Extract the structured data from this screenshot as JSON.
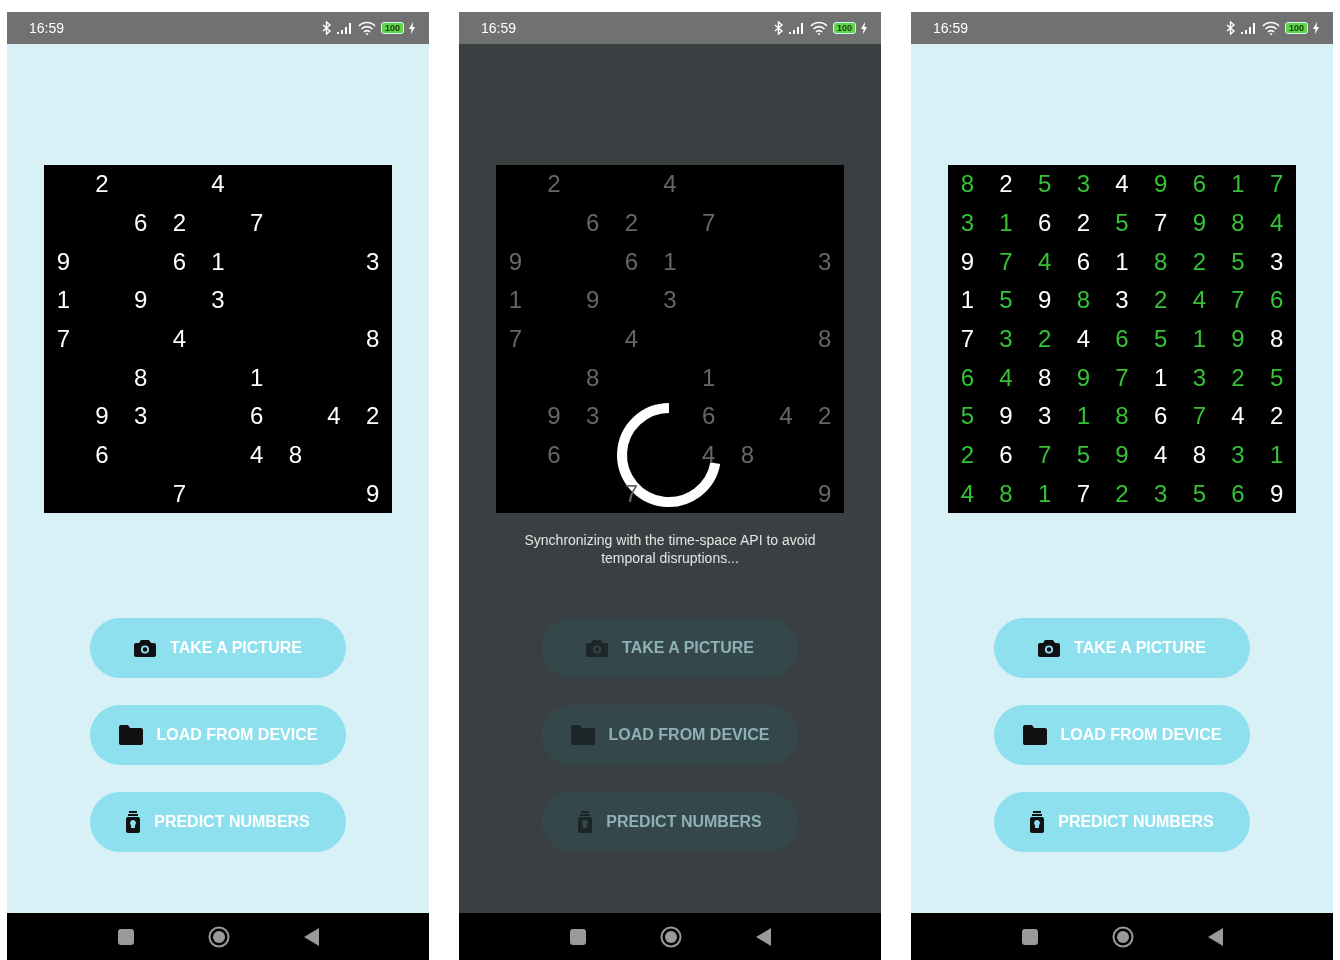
{
  "screens": [
    {
      "status_bar": {
        "time": "16:59",
        "battery": "100"
      },
      "grid": {
        "rows": [
          [
            null,
            {
              "digit": "2",
              "kind": "given"
            },
            null,
            null,
            {
              "digit": "4",
              "kind": "given"
            },
            null,
            null,
            null,
            null
          ],
          [
            null,
            null,
            {
              "digit": "6",
              "kind": "given"
            },
            {
              "digit": "2",
              "kind": "given"
            },
            null,
            {
              "digit": "7",
              "kind": "given"
            },
            null,
            null,
            null
          ],
          [
            {
              "digit": "9",
              "kind": "given"
            },
            null,
            null,
            {
              "digit": "6",
              "kind": "given"
            },
            {
              "digit": "1",
              "kind": "given"
            },
            null,
            null,
            null,
            {
              "digit": "3",
              "kind": "given"
            }
          ],
          [
            {
              "digit": "1",
              "kind": "given"
            },
            null,
            {
              "digit": "9",
              "kind": "given"
            },
            null,
            {
              "digit": "3",
              "kind": "given"
            },
            null,
            null,
            null,
            null
          ],
          [
            {
              "digit": "7",
              "kind": "given"
            },
            null,
            null,
            {
              "digit": "4",
              "kind": "given"
            },
            null,
            null,
            null,
            null,
            {
              "digit": "8",
              "kind": "given"
            }
          ],
          [
            null,
            null,
            {
              "digit": "8",
              "kind": "given"
            },
            null,
            null,
            {
              "digit": "1",
              "kind": "given"
            },
            null,
            null,
            null
          ],
          [
            null,
            {
              "digit": "9",
              "kind": "given"
            },
            {
              "digit": "3",
              "kind": "given"
            },
            null,
            null,
            {
              "digit": "6",
              "kind": "given"
            },
            null,
            {
              "digit": "4",
              "kind": "given"
            },
            {
              "digit": "2",
              "kind": "given"
            }
          ],
          [
            null,
            {
              "digit": "6",
              "kind": "given"
            },
            null,
            null,
            null,
            {
              "digit": "4",
              "kind": "given"
            },
            {
              "digit": "8",
              "kind": "given"
            },
            null,
            null
          ],
          [
            null,
            null,
            null,
            {
              "digit": "7",
              "kind": "given"
            },
            null,
            null,
            null,
            null,
            {
              "digit": "9",
              "kind": "given"
            }
          ]
        ]
      },
      "buttons": [
        {
          "label": "TAKE A PICTURE"
        },
        {
          "label": "LOAD FROM DEVICE"
        },
        {
          "label": "PREDICT NUMBERS"
        }
      ]
    },
    {
      "status_bar": {
        "time": "16:59",
        "battery": "100"
      },
      "grid": {
        "rows": [
          [
            null,
            {
              "digit": "2",
              "kind": "given"
            },
            null,
            null,
            {
              "digit": "4",
              "kind": "given"
            },
            null,
            null,
            null,
            null
          ],
          [
            null,
            null,
            {
              "digit": "6",
              "kind": "given"
            },
            {
              "digit": "2",
              "kind": "given"
            },
            null,
            {
              "digit": "7",
              "kind": "given"
            },
            null,
            null,
            null
          ],
          [
            {
              "digit": "9",
              "kind": "given"
            },
            null,
            null,
            {
              "digit": "6",
              "kind": "given"
            },
            {
              "digit": "1",
              "kind": "given"
            },
            null,
            null,
            null,
            {
              "digit": "3",
              "kind": "given"
            }
          ],
          [
            {
              "digit": "1",
              "kind": "given"
            },
            null,
            {
              "digit": "9",
              "kind": "given"
            },
            null,
            {
              "digit": "3",
              "kind": "given"
            },
            null,
            null,
            null,
            null
          ],
          [
            {
              "digit": "7",
              "kind": "given"
            },
            null,
            null,
            {
              "digit": "4",
              "kind": "given"
            },
            null,
            null,
            null,
            null,
            {
              "digit": "8",
              "kind": "given"
            }
          ],
          [
            null,
            null,
            {
              "digit": "8",
              "kind": "given"
            },
            null,
            null,
            {
              "digit": "1",
              "kind": "given"
            },
            null,
            null,
            null
          ],
          [
            null,
            {
              "digit": "9",
              "kind": "given"
            },
            {
              "digit": "3",
              "kind": "given"
            },
            null,
            null,
            {
              "digit": "6",
              "kind": "given"
            },
            null,
            {
              "digit": "4",
              "kind": "given"
            },
            {
              "digit": "2",
              "kind": "given"
            }
          ],
          [
            null,
            {
              "digit": "6",
              "kind": "given"
            },
            null,
            null,
            null,
            {
              "digit": "4",
              "kind": "given"
            },
            {
              "digit": "8",
              "kind": "given"
            },
            null,
            null
          ],
          [
            null,
            null,
            null,
            {
              "digit": "7",
              "kind": "given"
            },
            null,
            null,
            null,
            null,
            {
              "digit": "9",
              "kind": "given"
            }
          ]
        ]
      },
      "loading": {
        "message": "Synchronizing with the time-space API to avoid temporal disruptions..."
      },
      "buttons": [
        {
          "label": "TAKE A PICTURE"
        },
        {
          "label": "LOAD FROM DEVICE"
        },
        {
          "label": "PREDICT NUMBERS"
        }
      ]
    },
    {
      "status_bar": {
        "time": "16:59",
        "battery": "100"
      },
      "grid": {
        "rows": [
          [
            {
              "digit": "8",
              "kind": "predicted"
            },
            {
              "digit": "2",
              "kind": "given"
            },
            {
              "digit": "5",
              "kind": "predicted"
            },
            {
              "digit": "3",
              "kind": "predicted"
            },
            {
              "digit": "4",
              "kind": "given"
            },
            {
              "digit": "9",
              "kind": "predicted"
            },
            {
              "digit": "6",
              "kind": "predicted"
            },
            {
              "digit": "1",
              "kind": "predicted"
            },
            {
              "digit": "7",
              "kind": "predicted"
            }
          ],
          [
            {
              "digit": "3",
              "kind": "predicted"
            },
            {
              "digit": "1",
              "kind": "predicted"
            },
            {
              "digit": "6",
              "kind": "given"
            },
            {
              "digit": "2",
              "kind": "given"
            },
            {
              "digit": "5",
              "kind": "predicted"
            },
            {
              "digit": "7",
              "kind": "given"
            },
            {
              "digit": "9",
              "kind": "predicted"
            },
            {
              "digit": "8",
              "kind": "predicted"
            },
            {
              "digit": "4",
              "kind": "predicted"
            }
          ],
          [
            {
              "digit": "9",
              "kind": "given"
            },
            {
              "digit": "7",
              "kind": "predicted"
            },
            {
              "digit": "4",
              "kind": "predicted"
            },
            {
              "digit": "6",
              "kind": "given"
            },
            {
              "digit": "1",
              "kind": "given"
            },
            {
              "digit": "8",
              "kind": "predicted"
            },
            {
              "digit": "2",
              "kind": "predicted"
            },
            {
              "digit": "5",
              "kind": "predicted"
            },
            {
              "digit": "3",
              "kind": "given"
            }
          ],
          [
            {
              "digit": "1",
              "kind": "given"
            },
            {
              "digit": "5",
              "kind": "predicted"
            },
            {
              "digit": "9",
              "kind": "given"
            },
            {
              "digit": "8",
              "kind": "predicted"
            },
            {
              "digit": "3",
              "kind": "given"
            },
            {
              "digit": "2",
              "kind": "predicted"
            },
            {
              "digit": "4",
              "kind": "predicted"
            },
            {
              "digit": "7",
              "kind": "predicted"
            },
            {
              "digit": "6",
              "kind": "predicted"
            }
          ],
          [
            {
              "digit": "7",
              "kind": "given"
            },
            {
              "digit": "3",
              "kind": "predicted"
            },
            {
              "digit": "2",
              "kind": "predicted"
            },
            {
              "digit": "4",
              "kind": "given"
            },
            {
              "digit": "6",
              "kind": "predicted"
            },
            {
              "digit": "5",
              "kind": "predicted"
            },
            {
              "digit": "1",
              "kind": "predicted"
            },
            {
              "digit": "9",
              "kind": "predicted"
            },
            {
              "digit": "8",
              "kind": "given"
            }
          ],
          [
            {
              "digit": "6",
              "kind": "predicted"
            },
            {
              "digit": "4",
              "kind": "predicted"
            },
            {
              "digit": "8",
              "kind": "given"
            },
            {
              "digit": "9",
              "kind": "predicted"
            },
            {
              "digit": "7",
              "kind": "predicted"
            },
            {
              "digit": "1",
              "kind": "given"
            },
            {
              "digit": "3",
              "kind": "predicted"
            },
            {
              "digit": "2",
              "kind": "predicted"
            },
            {
              "digit": "5",
              "kind": "predicted"
            }
          ],
          [
            {
              "digit": "5",
              "kind": "predicted"
            },
            {
              "digit": "9",
              "kind": "given"
            },
            {
              "digit": "3",
              "kind": "given"
            },
            {
              "digit": "1",
              "kind": "predicted"
            },
            {
              "digit": "8",
              "kind": "predicted"
            },
            {
              "digit": "6",
              "kind": "given"
            },
            {
              "digit": "7",
              "kind": "predicted"
            },
            {
              "digit": "4",
              "kind": "given"
            },
            {
              "digit": "2",
              "kind": "given"
            }
          ],
          [
            {
              "digit": "2",
              "kind": "predicted"
            },
            {
              "digit": "6",
              "kind": "given"
            },
            {
              "digit": "7",
              "kind": "predicted"
            },
            {
              "digit": "5",
              "kind": "predicted"
            },
            {
              "digit": "9",
              "kind": "predicted"
            },
            {
              "digit": "4",
              "kind": "given"
            },
            {
              "digit": "8",
              "kind": "given"
            },
            {
              "digit": "3",
              "kind": "predicted"
            },
            {
              "digit": "1",
              "kind": "predicted"
            }
          ],
          [
            {
              "digit": "4",
              "kind": "predicted"
            },
            {
              "digit": "8",
              "kind": "predicted"
            },
            {
              "digit": "1",
              "kind": "predicted"
            },
            {
              "digit": "7",
              "kind": "given"
            },
            {
              "digit": "2",
              "kind": "predicted"
            },
            {
              "digit": "3",
              "kind": "predicted"
            },
            {
              "digit": "5",
              "kind": "predicted"
            },
            {
              "digit": "6",
              "kind": "predicted"
            },
            {
              "digit": "9",
              "kind": "given"
            }
          ]
        ]
      },
      "buttons": [
        {
          "label": "TAKE A PICTURE"
        },
        {
          "label": "LOAD FROM DEVICE"
        },
        {
          "label": "PREDICT NUMBERS"
        }
      ]
    }
  ]
}
